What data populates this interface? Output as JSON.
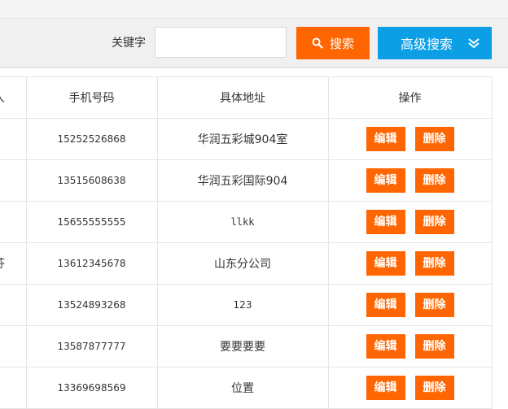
{
  "toolbar": {
    "keyword_label": "关键字",
    "keyword_value": "",
    "search_label": "搜索",
    "advanced_label": "高级搜索"
  },
  "table": {
    "headers": {
      "name": "人",
      "phone": "手机号码",
      "address": "具体地址",
      "ops": "操作"
    },
    "rows": [
      {
        "name": "",
        "phone": "15252526868",
        "address": "华润五彩城904室"
      },
      {
        "name": "",
        "phone": "13515608638",
        "address": "华润五彩国际904"
      },
      {
        "name": "",
        "phone": "15655555555",
        "address": "llkk"
      },
      {
        "name": "芬",
        "phone": "13612345678",
        "address": "山东分公司"
      },
      {
        "name": "",
        "phone": "13524893268",
        "address": "123"
      },
      {
        "name": "",
        "phone": "13587877777",
        "address": "要要要要"
      },
      {
        "name": "",
        "phone": "13369698569",
        "address": "位置"
      }
    ],
    "edit_label": "编辑",
    "delete_label": "删除"
  },
  "colors": {
    "primary_orange": "#ff6500",
    "primary_blue": "#0c9fe6"
  }
}
